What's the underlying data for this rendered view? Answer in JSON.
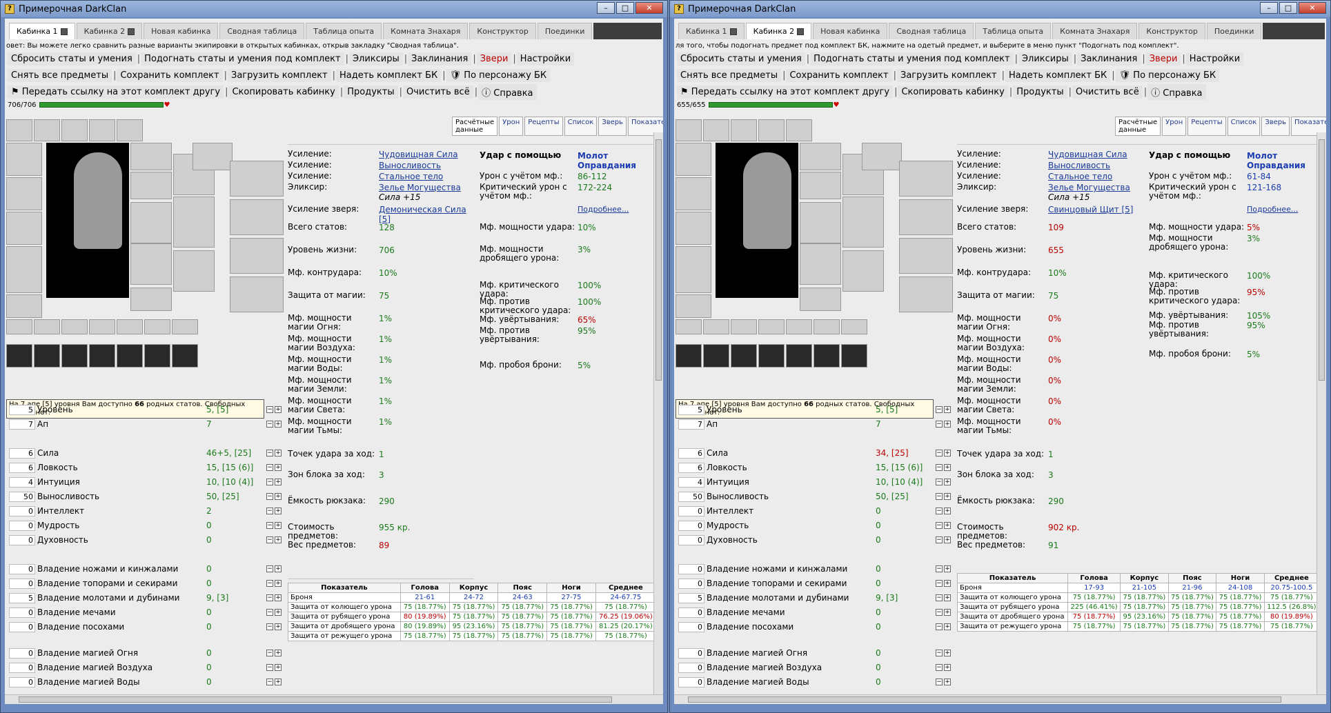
{
  "left": {
    "title": "Примерочная DarkClan",
    "tabs": [
      "Кабинка 1",
      "Кабинка 2",
      "Новая кабинка",
      "Сводная таблица",
      "Таблица опыта",
      "Комната Знахаря",
      "Конструктор",
      "Поединки"
    ],
    "active_tab": 0,
    "hint": "овет: Вы можете легко сравнить разные варианты экипировки в открытых кабинках, открыв закладку \"Сводная таблица\".",
    "tb1": [
      "Сбросить статы и умения",
      "Подогнать статы и умения под комплект",
      "Эликсиры",
      "Заклинания",
      "Звери",
      "Настройки"
    ],
    "tb2": [
      "Снять все предметы",
      "Сохранить комплект",
      "Загрузить комплект",
      "Надеть комплект БК",
      "По персонажу БК"
    ],
    "tb3": [
      "Передать ссылку на этот комплект другу",
      "Скопировать кабинку",
      "Продукты",
      "Очистить всё",
      "Справка"
    ],
    "hp": "706/706",
    "rtabs": [
      "Расчётные данные",
      "Урон",
      "Рецепты",
      "Список",
      "Зверь",
      "Показатели"
    ],
    "tooltip_pre": "На 7  апе [5] уровня Вам доступно ",
    "tooltip_num": "66",
    "tooltip_post": " родных статов. Свободных статов нет.",
    "stats": [
      {
        "box": "5",
        "name": "Уровень",
        "val": "5, [5]"
      },
      {
        "box": "7",
        "name": "Ап",
        "val": "7"
      },
      {
        "box": "6",
        "name": "Сила",
        "val": "46+5, [25]"
      },
      {
        "box": "6",
        "name": "Ловкость",
        "val": "15, [15 (6)]"
      },
      {
        "box": "4",
        "name": "Интуиция",
        "val": "10, [10 (4)]"
      },
      {
        "box": "50",
        "name": "Выносливость",
        "val": "50, [25]"
      },
      {
        "box": "0",
        "name": "Интеллект",
        "val": "2"
      },
      {
        "box": "0",
        "name": "Мудрость",
        "val": "0"
      },
      {
        "box": "0",
        "name": "Духовность",
        "val": "0"
      },
      {
        "box": "0",
        "name": "Владение ножами и кинжалами",
        "val": "0"
      },
      {
        "box": "0",
        "name": "Владение топорами и секирами",
        "val": "0"
      },
      {
        "box": "5",
        "name": "Владение молотами и дубинами",
        "val": "9, [3]"
      },
      {
        "box": "0",
        "name": "Владение мечами",
        "val": "0"
      },
      {
        "box": "0",
        "name": "Владение посохами",
        "val": "0"
      },
      {
        "box": "0",
        "name": "Владение магией Огня",
        "val": "0"
      },
      {
        "box": "0",
        "name": "Владение магией Воздуха",
        "val": "0"
      },
      {
        "box": "0",
        "name": "Владение магией Воды",
        "val": "0"
      }
    ],
    "buffs": [
      {
        "k": "Усиление:",
        "v": "Чудовищная Сила"
      },
      {
        "k": "Усиление:",
        "v": "Выносливость"
      },
      {
        "k": "Усиление:",
        "v": "Стальное тело"
      },
      {
        "k": "Эликсир:",
        "v": "Зелье Могущества",
        "v2": "Сила +15"
      },
      {
        "k": "Усиление зверя:",
        "v": "Демоническая Сила [5]"
      }
    ],
    "mstats": [
      {
        "k": "Всего статов:",
        "v": "128"
      },
      {
        "k": "Уровень жизни:",
        "v": "706"
      },
      {
        "k": "Мф. контрудара:",
        "v": "10%"
      },
      {
        "k": "Защита от магии:",
        "v": "75"
      },
      {
        "k": "Мф. мощности магии Огня:",
        "v": "1%"
      },
      {
        "k": "Мф. мощности магии Воздуха:",
        "v": "1%"
      },
      {
        "k": "Мф. мощности магии Воды:",
        "v": "1%"
      },
      {
        "k": "Мф. мощности магии Земли:",
        "v": "1%"
      },
      {
        "k": "Мф. мощности магии Света:",
        "v": "1%"
      },
      {
        "k": "Мф. мощности магии Тьмы:",
        "v": "1%"
      },
      {
        "k": "Точек удара за ход:",
        "v": "1"
      },
      {
        "k": "Зон блока за ход:",
        "v": "3"
      },
      {
        "k": "Ёмкость рюкзака:",
        "v": "290"
      },
      {
        "k": "Стоимость предметов:",
        "v": "955 кр."
      },
      {
        "k": "Вес предметов:",
        "v": "89"
      }
    ],
    "weapon": {
      "k": "Удар с помощью",
      "v": "Молот Оправдания"
    },
    "dmg": [
      {
        "k": "Урон с учётом мф.:",
        "v": "86-112"
      },
      {
        "k": "Критический урон с учётом мф.:",
        "v": "172-224"
      }
    ],
    "more": "Подробнее...",
    "mf": [
      {
        "k": "Мф. мощности удара:",
        "v": "10%"
      },
      {
        "k": "Мф. мощности дробящего урона:",
        "v": "3%"
      },
      {
        "k": "Мф. критического удара:",
        "v": "100%"
      },
      {
        "k": "Мф. против критического удара:",
        "v": "100%"
      },
      {
        "k": "Мф. увёртывания:",
        "v": "65%"
      },
      {
        "k": "Мф. против увёртывания:",
        "v": "95%"
      },
      {
        "k": "Мф. пробоя брони:",
        "v": "5%"
      }
    ],
    "table": {
      "head": [
        "Показатель",
        "Голова",
        "Корпус",
        "Пояс",
        "Ноги",
        "Среднее"
      ],
      "rows": [
        [
          "Броня",
          "21-61",
          "24-72",
          "24-63",
          "27-75",
          "24-67.75"
        ],
        [
          "Защита от колющего урона",
          "75 (18.77%)",
          "75 (18.77%)",
          "75 (18.77%)",
          "75 (18.77%)",
          "75 (18.77%)"
        ],
        [
          "Защита от рубящего урона",
          "80 (19.89%)",
          "75 (18.77%)",
          "75 (18.77%)",
          "75 (18.77%)",
          "76.25 (19.06%)"
        ],
        [
          "Защита от дробящего урона",
          "80 (19.89%)",
          "95 (23.16%)",
          "75 (18.77%)",
          "75 (18.77%)",
          "81.25 (20.17%)"
        ],
        [
          "Защита от режущего урона",
          "75 (18.77%)",
          "75 (18.77%)",
          "75 (18.77%)",
          "75 (18.77%)",
          "75 (18.77%)"
        ]
      ]
    }
  },
  "right": {
    "title": "Примерочная DarkClan",
    "tabs": [
      "Кабинка 1",
      "Кабинка 2",
      "Новая кабинка",
      "Сводная таблица",
      "Таблица опыта",
      "Комната Знахаря",
      "Конструктор",
      "Поединки"
    ],
    "active_tab": 1,
    "hint": "ля того, чтобы подогнать предмет под комплект БК, нажмите на одетый предмет, и выберите в меню пункт \"Подогнать под комплект\".",
    "tb1": [
      "Сбросить статы и умения",
      "Подогнать статы и умения под комплект",
      "Эликсиры",
      "Заклинания",
      "Звери",
      "Настройки"
    ],
    "tb2": [
      "Снять все предметы",
      "Сохранить комплект",
      "Загрузить комплект",
      "Надеть комплект БК",
      "По персонажу БК"
    ],
    "tb3": [
      "Передать ссылку на этот комплект другу",
      "Скопировать кабинку",
      "Продукты",
      "Очистить всё",
      "Справка"
    ],
    "hp": "655/655",
    "rtabs": [
      "Расчётные данные",
      "Урон",
      "Рецепты",
      "Список",
      "Зверь",
      "Показатели"
    ],
    "tooltip_pre": "На 7  апе [5] уровня Вам доступно ",
    "tooltip_num": "66",
    "tooltip_post": " родных статов. Свободных статов нет.",
    "stats": [
      {
        "box": "5",
        "name": "Уровень",
        "val": "5, [5]"
      },
      {
        "box": "7",
        "name": "Ап",
        "val": "7"
      },
      {
        "box": "6",
        "name": "Сила",
        "val": "34, [25]"
      },
      {
        "box": "6",
        "name": "Ловкость",
        "val": "15, [15 (6)]"
      },
      {
        "box": "4",
        "name": "Интуиция",
        "val": "10, [10 (4)]"
      },
      {
        "box": "50",
        "name": "Выносливость",
        "val": "50, [25]"
      },
      {
        "box": "0",
        "name": "Интеллект",
        "val": "0"
      },
      {
        "box": "0",
        "name": "Мудрость",
        "val": "0"
      },
      {
        "box": "0",
        "name": "Духовность",
        "val": "0"
      },
      {
        "box": "0",
        "name": "Владение ножами и кинжалами",
        "val": "0"
      },
      {
        "box": "0",
        "name": "Владение топорами и секирами",
        "val": "0"
      },
      {
        "box": "5",
        "name": "Владение молотами и дубинами",
        "val": "9, [3]"
      },
      {
        "box": "0",
        "name": "Владение мечами",
        "val": "0"
      },
      {
        "box": "0",
        "name": "Владение посохами",
        "val": "0"
      },
      {
        "box": "0",
        "name": "Владение магией Огня",
        "val": "0"
      },
      {
        "box": "0",
        "name": "Владение магией Воздуха",
        "val": "0"
      },
      {
        "box": "0",
        "name": "Владение магией Воды",
        "val": "0"
      }
    ],
    "buffs": [
      {
        "k": "Усиление:",
        "v": "Чудовищная Сила"
      },
      {
        "k": "Усиление:",
        "v": "Выносливость"
      },
      {
        "k": "Усиление:",
        "v": "Стальное тело"
      },
      {
        "k": "Эликсир:",
        "v": "Зелье Могущества",
        "v2": "Сила +15"
      },
      {
        "k": "Усиление зверя:",
        "v": "Свинцовый Щит [5]"
      }
    ],
    "mstats": [
      {
        "k": "Всего статов:",
        "v": "109"
      },
      {
        "k": "Уровень жизни:",
        "v": "655"
      },
      {
        "k": "Мф. контрудара:",
        "v": "10%"
      },
      {
        "k": "Защита от магии:",
        "v": "75"
      },
      {
        "k": "Мф. мощности магии Огня:",
        "v": "0%"
      },
      {
        "k": "Мф. мощности магии Воздуха:",
        "v": "0%"
      },
      {
        "k": "Мф. мощности магии Воды:",
        "v": "0%"
      },
      {
        "k": "Мф. мощности магии Земли:",
        "v": "0%"
      },
      {
        "k": "Мф. мощности магии Света:",
        "v": "0%"
      },
      {
        "k": "Мф. мощности магии Тьмы:",
        "v": "0%"
      },
      {
        "k": "Точек удара за ход:",
        "v": "1"
      },
      {
        "k": "Зон блока за ход:",
        "v": "3"
      },
      {
        "k": "Ёмкость рюкзака:",
        "v": "290"
      },
      {
        "k": "Стоимость предметов:",
        "v": "902 кр."
      },
      {
        "k": "Вес предметов:",
        "v": "91"
      }
    ],
    "weapon": {
      "k": "Удар с помощью",
      "v": "Молот Оправдания"
    },
    "dmg": [
      {
        "k": "Урон с учётом мф.:",
        "v": "61-84"
      },
      {
        "k": "Критический урон с учётом мф.:",
        "v": "121-168"
      }
    ],
    "more": "Подробнее...",
    "mf": [
      {
        "k": "Мф. мощности удара:",
        "v": "5%"
      },
      {
        "k": "Мф. мощности дробящего урона:",
        "v": "3%"
      },
      {
        "k": "Мф. критического удара:",
        "v": "100%"
      },
      {
        "k": "Мф. против критического удара:",
        "v": "95%"
      },
      {
        "k": "Мф. увёртывания:",
        "v": "105%"
      },
      {
        "k": "Мф. против увёртывания:",
        "v": "95%"
      },
      {
        "k": "Мф. пробоя брони:",
        "v": "5%"
      }
    ],
    "table": {
      "head": [
        "Показатель",
        "Голова",
        "Корпус",
        "Пояс",
        "Ноги",
        "Среднее"
      ],
      "rows": [
        [
          "Броня",
          "17-93",
          "21-105",
          "21-96",
          "24-108",
          "20.75-100.5"
        ],
        [
          "Защита от колющего урона",
          "75 (18.77%)",
          "75 (18.77%)",
          "75 (18.77%)",
          "75 (18.77%)",
          "75 (18.77%)"
        ],
        [
          "Защита от рубящего урона",
          "225 (46.41%)",
          "75 (18.77%)",
          "75 (18.77%)",
          "75 (18.77%)",
          "112.5 (26.8%)"
        ],
        [
          "Защита от дробящего урона",
          "75 (18.77%)",
          "95 (23.16%)",
          "75 (18.77%)",
          "75 (18.77%)",
          "80 (19.89%)"
        ],
        [
          "Защита от режущего урона",
          "75 (18.77%)",
          "75 (18.77%)",
          "75 (18.77%)",
          "75 (18.77%)",
          "75 (18.77%)"
        ]
      ]
    }
  },
  "colors": {
    "green": "#1a7a1a",
    "red": "#b00",
    "blue": "#1a3cb0"
  }
}
